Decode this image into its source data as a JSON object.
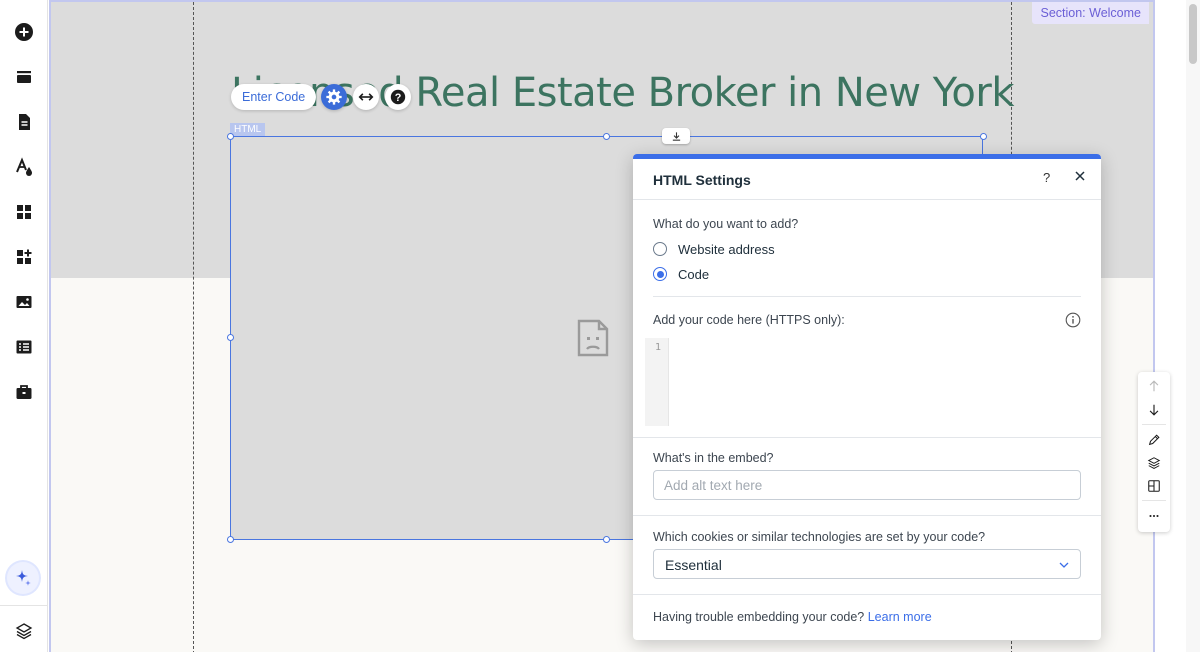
{
  "canvas": {
    "section_label": "Section: Welcome",
    "headline": "Licensed Real Estate Broker in New York"
  },
  "element_toolbar": {
    "enter_code_label": "Enter Code",
    "settings_icon": "gear-icon",
    "stretch_icon": "horizontal-arrows-icon",
    "help_icon": "question-icon"
  },
  "html_element": {
    "tag_label": "HTML",
    "placeholder_icon": "broken-document-icon"
  },
  "panel": {
    "title": "HTML Settings",
    "help_label": "?",
    "question1": "What do you want to add?",
    "options": [
      {
        "label": "Website address",
        "selected": false
      },
      {
        "label": "Code",
        "selected": true
      }
    ],
    "code_label": "Add your code here (HTTPS only):",
    "code_line_number": "1",
    "embed_label": "What's in the embed?",
    "alt_placeholder": "Add alt text here",
    "cookies_label": "Which cookies or similar technologies are set by your code?",
    "cookies_value": "Essential",
    "footer_text": "Having trouble embedding your code?",
    "footer_link": "Learn more"
  },
  "left_toolbar": {
    "items": [
      "add-icon",
      "sections-icon",
      "pages-icon",
      "design-icon",
      "apps-icon",
      "add-apps-icon",
      "media-icon",
      "cms-icon",
      "business-icon"
    ],
    "ai_icon": "ai-sparkle-icon",
    "layers_icon": "layers-icon"
  },
  "right_toolbar": {
    "items": [
      "arrow-up-icon",
      "arrow-down-icon",
      "edit-icon",
      "layers-icon",
      "layout-icon",
      "more-icon"
    ]
  },
  "colors": {
    "accent": "#3b6ee8",
    "headline": "#3c7460",
    "section_label_bg": "#e7e4fb",
    "section_label_text": "#6b5fd6"
  }
}
